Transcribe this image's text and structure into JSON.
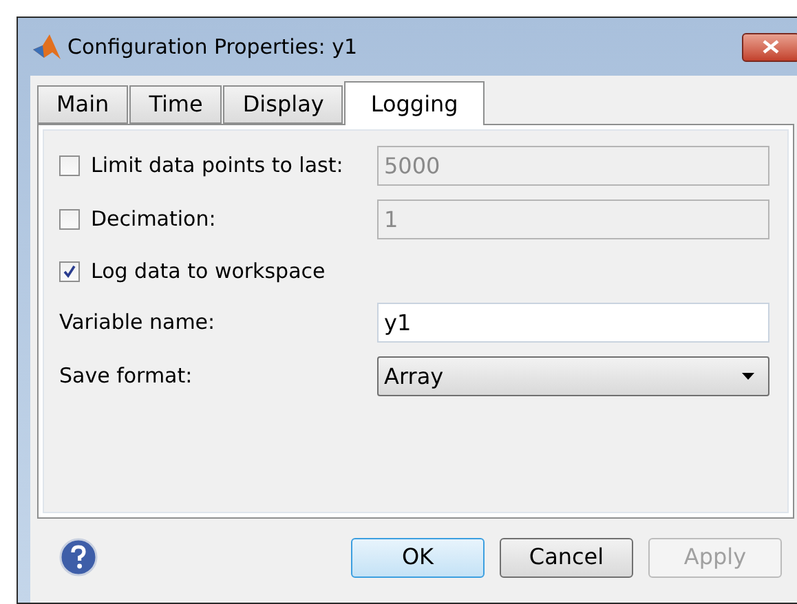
{
  "window": {
    "title": "Configuration Properties: y1"
  },
  "tabs": [
    {
      "label": "Main",
      "selected": false
    },
    {
      "label": "Time",
      "selected": false
    },
    {
      "label": "Display",
      "selected": false
    },
    {
      "label": "Logging",
      "selected": true
    }
  ],
  "rows": [
    {
      "kind": "checkbox-field",
      "label": "Limit data points to last:",
      "checked": false,
      "value": "5000",
      "disabled": true
    },
    {
      "kind": "checkbox-field",
      "label": "Decimation:",
      "checked": false,
      "value": "1",
      "disabled": true
    },
    {
      "kind": "checkbox",
      "label": "Log data to workspace",
      "checked": true
    },
    {
      "kind": "field",
      "label": "Variable name:",
      "value": "y1",
      "disabled": false
    },
    {
      "kind": "dropdown",
      "label": "Save format:",
      "value": "Array"
    }
  ],
  "buttons": [
    {
      "label": "OK",
      "default": true,
      "disabled": false
    },
    {
      "label": "Cancel",
      "default": false,
      "disabled": false
    },
    {
      "label": "Apply",
      "default": false,
      "disabled": true
    }
  ]
}
